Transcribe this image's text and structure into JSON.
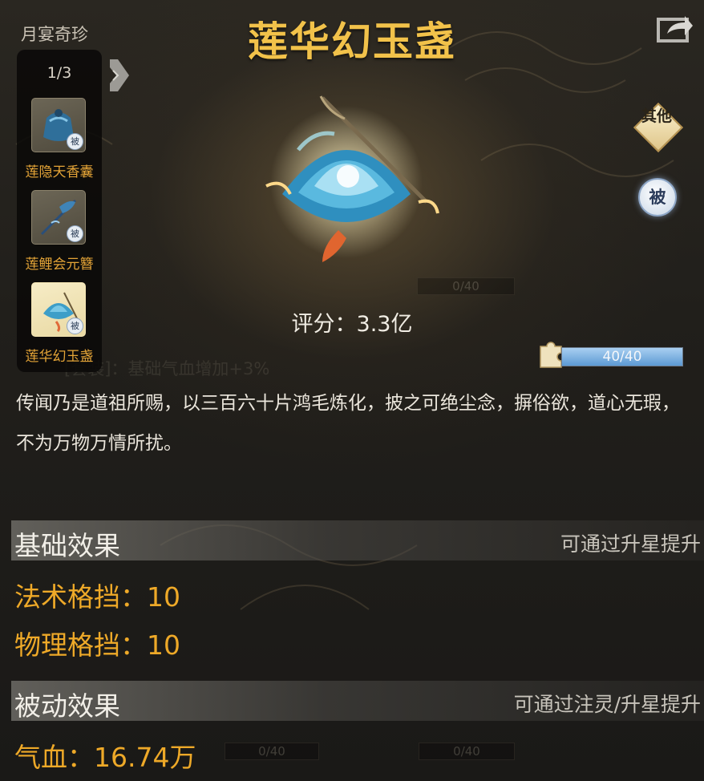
{
  "collection": {
    "title": "月宴奇珍",
    "page_indicator": "1/3",
    "items": [
      {
        "label": "莲隐天香囊",
        "badge": "被",
        "active": false
      },
      {
        "label": "莲鲤会元簪",
        "badge": "被",
        "active": false
      },
      {
        "label": "莲华幻玉盏",
        "badge": "被",
        "active": true
      }
    ]
  },
  "item": {
    "title": "莲华幻玉盏",
    "score_label": "评分：",
    "score_value": "3.3亿",
    "tags": {
      "other": "其他",
      "passive": "被"
    },
    "fragments": {
      "text": "40/40",
      "current": 40,
      "max": 40
    },
    "description": "传闻乃是道祖所赐，以三百六十片鸿毛炼化，披之可绝尘念，摒俗欲，道心无瑕，不为万物万情所扰。"
  },
  "base_effect": {
    "title": "基础效果",
    "hint": "可通过升星提升",
    "stats": [
      "法术格挡：10",
      "物理格挡：10"
    ]
  },
  "passive_effect": {
    "title": "被动效果",
    "hint": "可通过注灵/升星提升",
    "stats": [
      "气血：16.74万"
    ]
  },
  "icons": [
    "share-icon",
    "nav-next-arrow-icon",
    "puzzle-fragment-icon"
  ],
  "colors": {
    "title_gold": "#f2c24a",
    "stat_orange": "#eea928",
    "nav_label": "#e4a437",
    "progress_blue": "#7fb5e6"
  }
}
